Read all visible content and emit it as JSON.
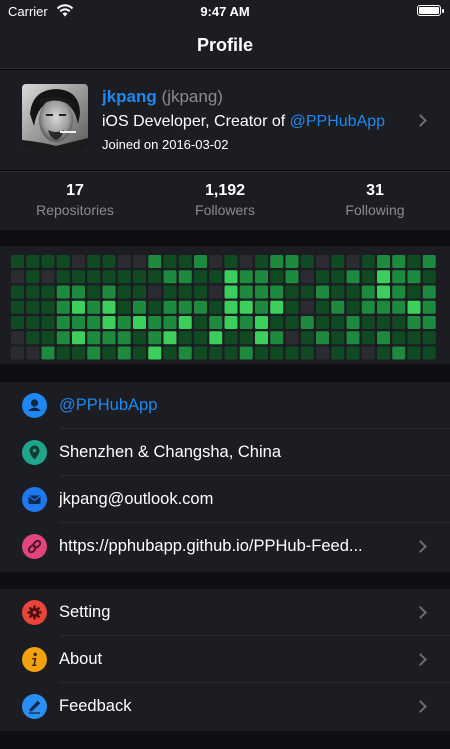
{
  "status_bar": {
    "carrier": "Carrier",
    "time": "9:47 AM",
    "wifi_icon": "wifi-icon",
    "battery_icon": "battery-icon",
    "battery_level": 1.0
  },
  "nav": {
    "title": "Profile"
  },
  "profile": {
    "display_name": "jkpang",
    "login": "(jkpang)",
    "bio_prefix": "iOS Developer, Creator of ",
    "bio_handle": "@PPHubApp",
    "joined": "Joined on 2016-03-02"
  },
  "stats": [
    {
      "value": "17",
      "label": "Repositories"
    },
    {
      "value": "1,192",
      "label": "Followers"
    },
    {
      "value": "31",
      "label": "Following"
    }
  ],
  "contributions": {
    "weeks": 28,
    "days": 7,
    "levels_by_week": [
      [
        1,
        0,
        1,
        1,
        1,
        0,
        0
      ],
      [
        1,
        1,
        1,
        1,
        1,
        1,
        0
      ],
      [
        1,
        0,
        1,
        1,
        1,
        1,
        2
      ],
      [
        1,
        1,
        2,
        2,
        2,
        2,
        1
      ],
      [
        0,
        1,
        2,
        3,
        2,
        3,
        1
      ],
      [
        1,
        1,
        1,
        2,
        2,
        2,
        2
      ],
      [
        1,
        1,
        2,
        3,
        3,
        2,
        1
      ],
      [
        0,
        1,
        1,
        1,
        2,
        2,
        2
      ],
      [
        0,
        1,
        1,
        2,
        3,
        1,
        1
      ],
      [
        2,
        1,
        0,
        1,
        2,
        2,
        3
      ],
      [
        1,
        2,
        1,
        2,
        2,
        3,
        1
      ],
      [
        1,
        2,
        1,
        2,
        3,
        1,
        2
      ],
      [
        2,
        1,
        1,
        2,
        1,
        1,
        1
      ],
      [
        0,
        1,
        0,
        1,
        2,
        3,
        1
      ],
      [
        1,
        3,
        3,
        3,
        3,
        1,
        1
      ],
      [
        0,
        2,
        2,
        3,
        2,
        1,
        2
      ],
      [
        1,
        2,
        2,
        2,
        3,
        3,
        1
      ],
      [
        2,
        1,
        2,
        3,
        1,
        2,
        1
      ],
      [
        2,
        2,
        1,
        1,
        1,
        0,
        1
      ],
      [
        1,
        0,
        1,
        0,
        2,
        1,
        1
      ],
      [
        0,
        1,
        2,
        1,
        1,
        2,
        0
      ],
      [
        1,
        1,
        1,
        2,
        1,
        1,
        1
      ],
      [
        0,
        2,
        1,
        1,
        2,
        2,
        1
      ],
      [
        1,
        1,
        2,
        2,
        1,
        1,
        0
      ],
      [
        2,
        3,
        3,
        2,
        1,
        2,
        1
      ],
      [
        2,
        2,
        2,
        2,
        1,
        1,
        2
      ],
      [
        1,
        2,
        1,
        3,
        2,
        1,
        1
      ],
      [
        2,
        1,
        2,
        2,
        2,
        1,
        1
      ]
    ],
    "colors": [
      "#2a2c31",
      "#0f4a23",
      "#1d8a3d",
      "#3ccf5c"
    ]
  },
  "info_rows": [
    {
      "icon": "person-icon",
      "icon_color": "#1e88f0",
      "label": "@PPHubApp",
      "is_link": true
    },
    {
      "icon": "location-pin-icon",
      "icon_color": "#1fa58c",
      "label": "Shenzhen & Changsha, China",
      "is_link": false
    },
    {
      "icon": "mail-icon",
      "icon_color": "#1e78ee",
      "label": "jkpang@outlook.com",
      "is_link": false
    },
    {
      "icon": "link-icon",
      "icon_color": "#e0457b",
      "label": "https://pphubapp.github.io/PPHub-Feed...",
      "is_link": false
    }
  ],
  "menu_rows": [
    {
      "icon": "gear-icon",
      "icon_color": "#e8443a",
      "label": "Setting"
    },
    {
      "icon": "info-icon",
      "icon_color": "#f2a20f",
      "label": "About"
    },
    {
      "icon": "pencil-icon",
      "icon_color": "#2a8ff0",
      "label": "Feedback"
    }
  ]
}
